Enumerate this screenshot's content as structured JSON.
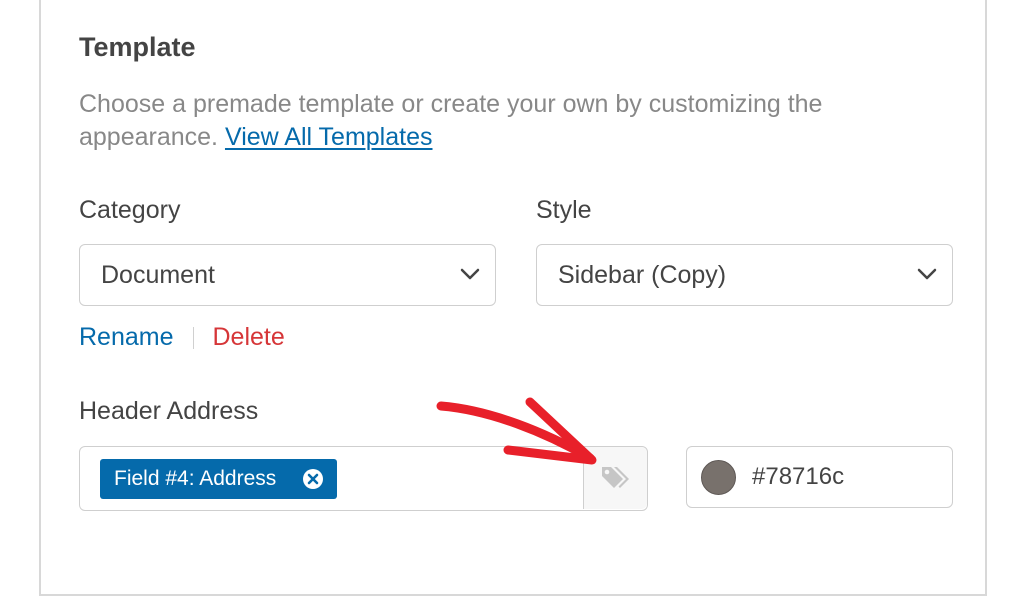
{
  "template_section": {
    "title": "Template",
    "description": "Choose a premade template or create your own by customizing the appearance.",
    "view_all_link": "View All Templates"
  },
  "category": {
    "label": "Category",
    "selected": "Document"
  },
  "style": {
    "label": "Style",
    "selected": "Sidebar (Copy)"
  },
  "actions": {
    "rename": "Rename",
    "delete": "Delete"
  },
  "header_address": {
    "label": "Header Address",
    "chip": "Field #4: Address",
    "tag_icon": "tags-icon"
  },
  "header_color": {
    "value": "#78716c"
  },
  "colors": {
    "accent": "#056aab",
    "danger": "#d63638",
    "annotation": "#e8202a"
  }
}
